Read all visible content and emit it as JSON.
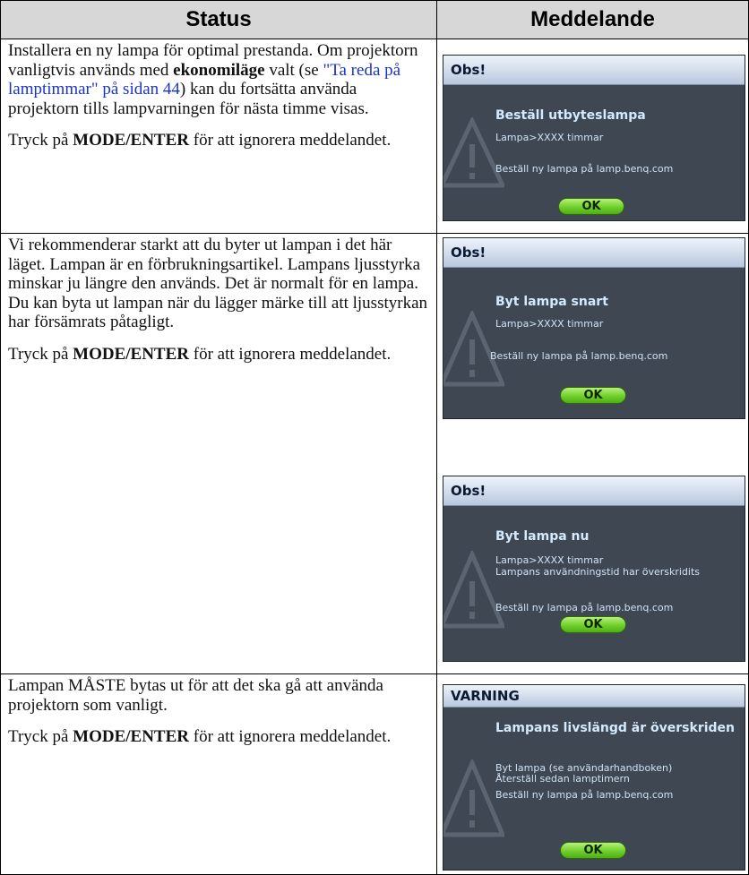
{
  "header": {
    "status": "Status",
    "message": "Meddelande"
  },
  "rows": [
    {
      "p1_pre": "Installera en ny lampa för optimal prestanda. Om projektorn vanligtvis används med ",
      "p1_bold": "ekonomiläge",
      "p1_mid": " valt (se ",
      "p1_link": "\"Ta reda på lamptimmar\" på sidan 44",
      "p1_post": ") kan du fortsätta använda projektorn tills lampvarningen för nästa timme visas.",
      "p2_pre": "Tryck på ",
      "p2_bold": "MODE/ENTER",
      "p2_post": " för att ignorera meddelandet."
    },
    {
      "p1": "Vi rekommenderar starkt att du byter ut lampan i det här läget. Lampan är en förbrukningsartikel. Lampans ljusstyrka minskar ju längre den används. Det är normalt för en lampa. Du kan byta ut lampan när du lägger märke till att ljusstyrkan har försämrats påtagligt.",
      "p2_pre": "Tryck på ",
      "p2_bold": "MODE/ENTER",
      "p2_post": " för att ignorera meddelandet."
    },
    {
      "p1": "Lampan MÅSTE bytas ut för att det ska gå att använda projektorn som vanligt.",
      "p2_pre": "Tryck på ",
      "p2_bold": "MODE/ENTER",
      "p2_post": " för att ignorera meddelandet."
    }
  ],
  "dialogs": [
    {
      "title": "Obs!",
      "heading": "Beställ utbyteslampa",
      "line1": "Lampa>XXXX timmar",
      "line2": "",
      "line3": "Beställ ny lampa på lamp.benq.com",
      "ok": "OK"
    },
    {
      "title": "Obs!",
      "heading": "Byt lampa snart",
      "line1": "Lampa>XXXX timmar",
      "line2": "",
      "line3": "Beställ ny lampa på lamp.benq.com",
      "ok": "OK"
    },
    {
      "title": "Obs!",
      "heading": "Byt lampa nu",
      "line1": "Lampa>XXXX timmar",
      "line2": "Lampans användningstid har överskridits",
      "line3": "Beställ ny lampa på lamp.benq.com",
      "ok": "OK"
    },
    {
      "title": "VARNING",
      "heading": "Lampans livslängd är överskriden",
      "line1": "Byt lampa (se användarhandboken)",
      "line2": "Återställ sedan lamptimern",
      "line3": "Beställ ny lampa på lamp.benq.com",
      "ok": "OK"
    }
  ],
  "colors": {
    "dialog_bg": "#3e4752",
    "title_bar": "#c9d6e8",
    "ok_green": "#6fcf2b",
    "link": "#1a33cc"
  },
  "icons": {
    "dialog_watermark": "warning-triangle-icon"
  }
}
